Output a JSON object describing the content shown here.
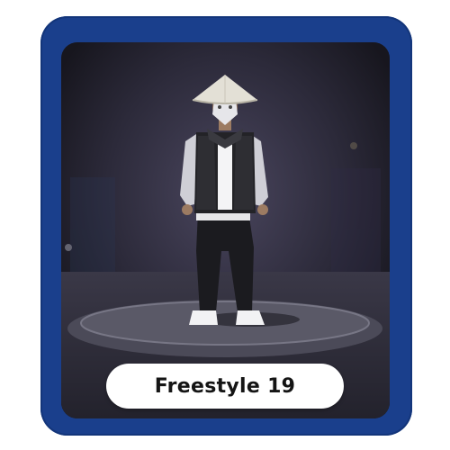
{
  "card": {
    "frame_color": "#1a3f8c",
    "label": "Freestyle 19"
  },
  "character": {
    "hat": "conical-straw-hat",
    "mask": "white-mask",
    "jacket": "black-and-white-hooded-jacket",
    "pants": "black-jogger-pants",
    "shoes": "white-sneakers"
  }
}
